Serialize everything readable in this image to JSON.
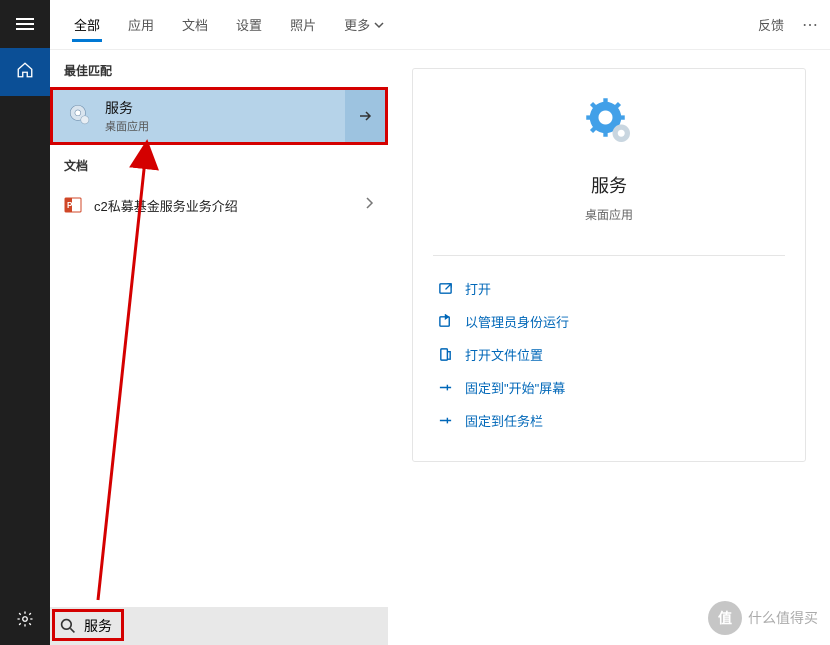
{
  "tabs": [
    "全部",
    "应用",
    "文档",
    "设置",
    "照片",
    "更多"
  ],
  "active_tab": "全部",
  "feedback_label": "反馈",
  "sections": {
    "best_match": "最佳匹配",
    "documents": "文档"
  },
  "best_match": {
    "title": "服务",
    "subtitle": "桌面应用"
  },
  "doc_result": {
    "label": "c2私募基金服务业务介绍"
  },
  "detail": {
    "title": "服务",
    "subtitle": "桌面应用",
    "actions": [
      {
        "label": "打开",
        "icon": "open"
      },
      {
        "label": "以管理员身份运行",
        "icon": "admin"
      },
      {
        "label": "打开文件位置",
        "icon": "folder"
      },
      {
        "label": "固定到\"开始\"屏幕",
        "icon": "pin"
      },
      {
        "label": "固定到任务栏",
        "icon": "pin"
      }
    ]
  },
  "search": {
    "value": "服务",
    "placeholder": ""
  },
  "watermark": {
    "glyph": "值",
    "text": "什么值得买"
  }
}
